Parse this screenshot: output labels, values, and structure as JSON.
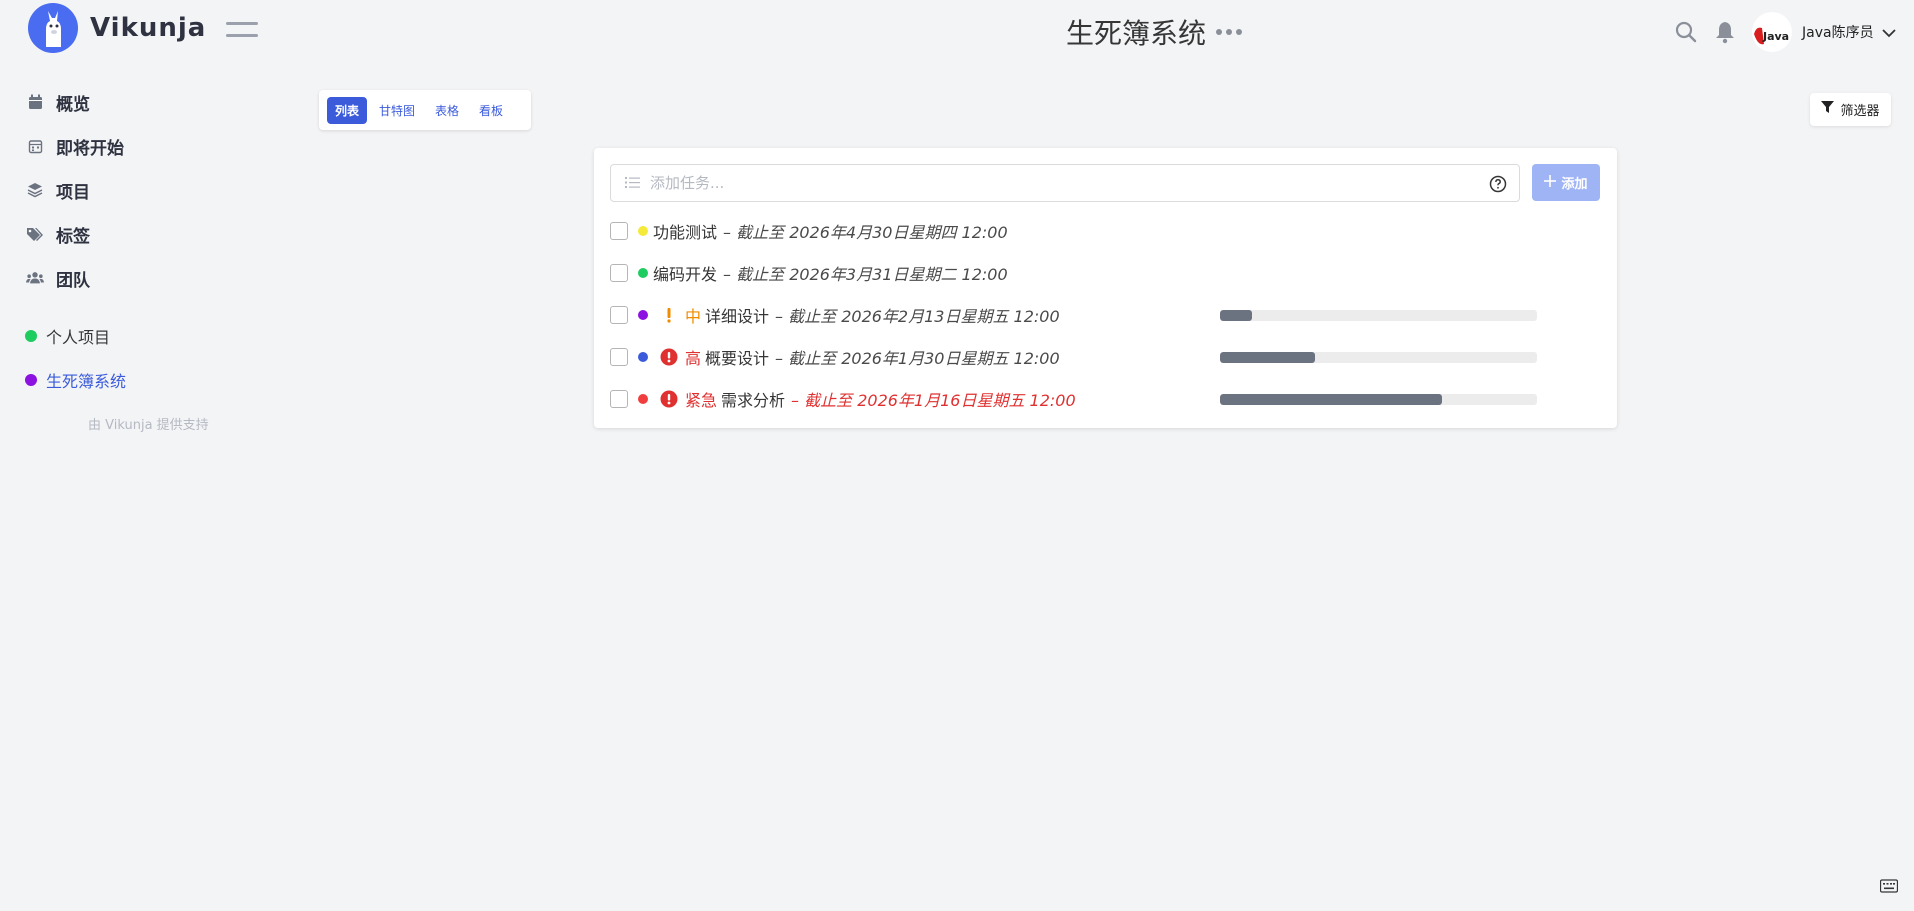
{
  "app": {
    "name": "Vikunja",
    "project_title": "生死簿系统"
  },
  "user": {
    "name": "Java陈序员",
    "avatar_text": "Java"
  },
  "sidebar": {
    "nav": [
      {
        "label": "概览",
        "icon": "calendar-icon"
      },
      {
        "label": "即将开始",
        "icon": "calendar-grid-icon"
      },
      {
        "label": "项目",
        "icon": "layers-icon"
      },
      {
        "label": "标签",
        "icon": "tags-icon"
      },
      {
        "label": "团队",
        "icon": "users-icon"
      }
    ],
    "projects": [
      {
        "label": "个人项目",
        "color": "#1fcc5f"
      },
      {
        "label": "生死簿系统",
        "color": "#8b12e0"
      }
    ],
    "powered_by": "由 Vikunja 提供支持"
  },
  "views": {
    "list": "列表",
    "gantt": "甘特图",
    "table": "表格",
    "kanban": "看板"
  },
  "filter": {
    "label": "筛选器"
  },
  "add_task": {
    "placeholder": "添加任务...",
    "button": "添加"
  },
  "tasks": [
    {
      "title": "功能测试",
      "due": "– 截止至 2026年4月30日星期四 12:00",
      "color": "#f5e93a",
      "priority": "",
      "progress": 0
    },
    {
      "title": "编码开发",
      "due": "– 截止至 2026年3月31日星期二 12:00",
      "color": "#1fcc5f",
      "priority": "",
      "progress": 0
    },
    {
      "title": "详细设计",
      "due": "– 截止至 2026年2月13日星期五 12:00",
      "color": "#8b12e0",
      "priority": "中",
      "priority_color": "#f08c00",
      "progress": 0.1
    },
    {
      "title": "概要设计",
      "due": "– 截止至 2026年1月30日星期五 12:00",
      "color": "#3b5bdb",
      "priority": "高",
      "priority_color": "#e03131",
      "progress": 0.3
    },
    {
      "title": "需求分析",
      "due": "– 截止至 2026年1月16日星期五 12:00",
      "color": "#f03e3e",
      "priority": "紧急",
      "priority_color": "#e03131",
      "progress": 0.7,
      "overdue": true
    }
  ]
}
